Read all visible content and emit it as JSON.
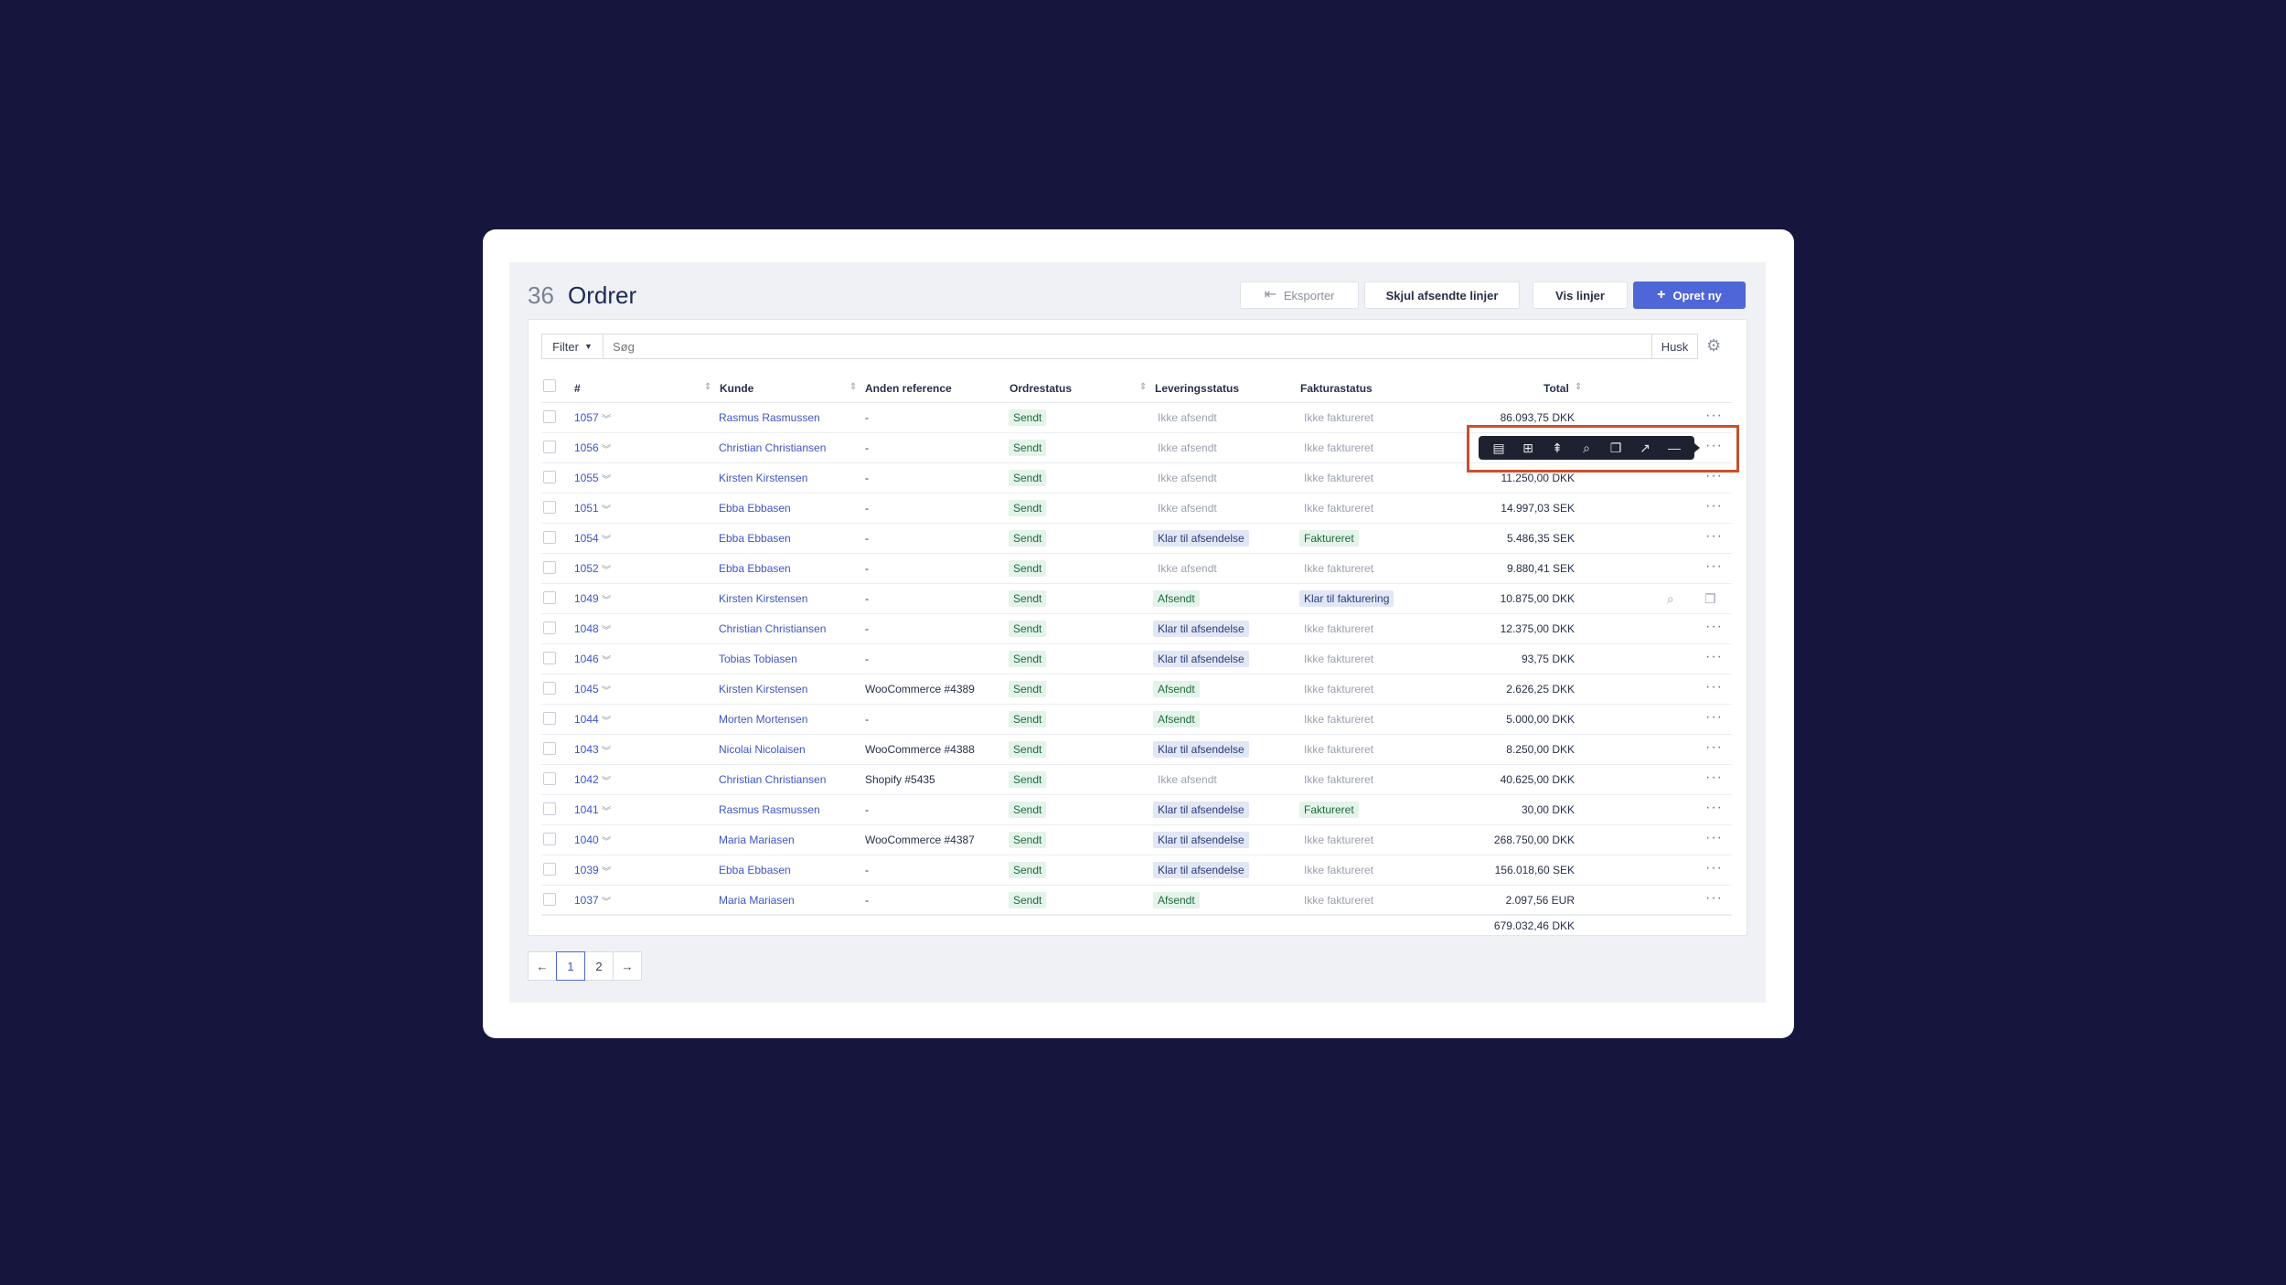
{
  "header": {
    "count": "36",
    "title": "Ordrer",
    "export_label": "Eksporter",
    "hide_sent_label": "Skjul afsendte linjer",
    "show_lines_label": "Vis linjer",
    "create_label": "Opret ny"
  },
  "filterbar": {
    "filter_label": "Filter",
    "search_placeholder": "Søg",
    "remember_label": "Husk"
  },
  "columns": {
    "number": "#",
    "customer": "Kunde",
    "reference": "Anden reference",
    "order_status": "Ordrestatus",
    "delivery_status": "Leveringsstatus",
    "invoice_status": "Fakturastatus",
    "total": "Total"
  },
  "rows": [
    {
      "id": "1057",
      "customer": "Rasmus Rasmussen",
      "ref": "-",
      "ostat": "Sendt",
      "lev": "Ikke afsendt",
      "lev_kind": "plain",
      "fakt": "Ikke faktureret",
      "fakt_kind": "plain",
      "total": "86.093,75 DKK"
    },
    {
      "id": "1056",
      "customer": "Christian Christiansen",
      "ref": "-",
      "ostat": "Sendt",
      "lev": "Ikke afsendt",
      "lev_kind": "plain",
      "fakt": "Ikke faktureret",
      "fakt_kind": "plain",
      "total": ""
    },
    {
      "id": "1055",
      "customer": "Kirsten Kirstensen",
      "ref": "-",
      "ostat": "Sendt",
      "lev": "Ikke afsendt",
      "lev_kind": "plain",
      "fakt": "Ikke faktureret",
      "fakt_kind": "plain",
      "total": "11.250,00 DKK"
    },
    {
      "id": "1051",
      "customer": "Ebba Ebbasen",
      "ref": "-",
      "ostat": "Sendt",
      "lev": "Ikke afsendt",
      "lev_kind": "plain",
      "fakt": "Ikke faktureret",
      "fakt_kind": "plain",
      "total": "14.997,03 SEK"
    },
    {
      "id": "1054",
      "customer": "Ebba Ebbasen",
      "ref": "-",
      "ostat": "Sendt",
      "lev": "Klar til afsendelse",
      "lev_kind": "blue",
      "fakt": "Faktureret",
      "fakt_kind": "green",
      "total": "5.486,35 SEK"
    },
    {
      "id": "1052",
      "customer": "Ebba Ebbasen",
      "ref": "-",
      "ostat": "Sendt",
      "lev": "Ikke afsendt",
      "lev_kind": "plain",
      "fakt": "Ikke faktureret",
      "fakt_kind": "plain",
      "total": "9.880,41 SEK"
    },
    {
      "id": "1049",
      "customer": "Kirsten Kirstensen",
      "ref": "-",
      "ostat": "Sendt",
      "lev": "Afsendt",
      "lev_kind": "green",
      "fakt": "Klar til fakturering",
      "fakt_kind": "blue",
      "total": "10.875,00 DKK"
    },
    {
      "id": "1048",
      "customer": "Christian Christiansen",
      "ref": "-",
      "ostat": "Sendt",
      "lev": "Klar til afsendelse",
      "lev_kind": "blue",
      "fakt": "Ikke faktureret",
      "fakt_kind": "plain",
      "total": "12.375,00 DKK"
    },
    {
      "id": "1046",
      "customer": "Tobias Tobiasen",
      "ref": "-",
      "ostat": "Sendt",
      "lev": "Klar til afsendelse",
      "lev_kind": "blue",
      "fakt": "Ikke faktureret",
      "fakt_kind": "plain",
      "total": "93,75 DKK"
    },
    {
      "id": "1045",
      "customer": "Kirsten Kirstensen",
      "ref": "WooCommerce #4389",
      "ostat": "Sendt",
      "lev": "Afsendt",
      "lev_kind": "green",
      "fakt": "Ikke faktureret",
      "fakt_kind": "plain",
      "total": "2.626,25 DKK"
    },
    {
      "id": "1044",
      "customer": "Morten Mortensen",
      "ref": "-",
      "ostat": "Sendt",
      "lev": "Afsendt",
      "lev_kind": "green",
      "fakt": "Ikke faktureret",
      "fakt_kind": "plain",
      "total": "5.000,00 DKK"
    },
    {
      "id": "1043",
      "customer": "Nicolai Nicolaisen",
      "ref": "WooCommerce #4388",
      "ostat": "Sendt",
      "lev": "Klar til afsendelse",
      "lev_kind": "blue",
      "fakt": "Ikke faktureret",
      "fakt_kind": "plain",
      "total": "8.250,00 DKK"
    },
    {
      "id": "1042",
      "customer": "Christian Christiansen",
      "ref": "Shopify #5435",
      "ostat": "Sendt",
      "lev": "Ikke afsendt",
      "lev_kind": "plain",
      "fakt": "Ikke faktureret",
      "fakt_kind": "plain",
      "total": "40.625,00 DKK"
    },
    {
      "id": "1041",
      "customer": "Rasmus Rasmussen",
      "ref": "-",
      "ostat": "Sendt",
      "lev": "Klar til afsendelse",
      "lev_kind": "blue",
      "fakt": "Faktureret",
      "fakt_kind": "green",
      "total": "30,00 DKK"
    },
    {
      "id": "1040",
      "customer": "Maria Mariasen",
      "ref": "WooCommerce #4387",
      "ostat": "Sendt",
      "lev": "Klar til afsendelse",
      "lev_kind": "blue",
      "fakt": "Ikke faktureret",
      "fakt_kind": "plain",
      "total": "268.750,00 DKK"
    },
    {
      "id": "1039",
      "customer": "Ebba Ebbasen",
      "ref": "-",
      "ostat": "Sendt",
      "lev": "Klar til afsendelse",
      "lev_kind": "blue",
      "fakt": "Ikke faktureret",
      "fakt_kind": "plain",
      "total": "156.018,60 SEK"
    },
    {
      "id": "1037",
      "customer": "Maria Mariasen",
      "ref": "-",
      "ostat": "Sendt",
      "lev": "Afsendt",
      "lev_kind": "green",
      "fakt": "Ikke faktureret",
      "fakt_kind": "plain",
      "total": "2.097,56 EUR"
    }
  ],
  "sum_total": "679.032,46 DKK",
  "pagination": {
    "prev_icon": "arrow-left-icon",
    "pages": [
      "1",
      "2"
    ],
    "current": "1",
    "next_icon": "arrow-right-icon"
  },
  "toolbar_icons": [
    "collapse-icon",
    "add-line-icon",
    "insert-line-icon",
    "search-doc-icon",
    "copy-icon",
    "open-external-icon",
    "minus-icon"
  ],
  "colors": {
    "background": "#15153d",
    "accent": "#4f66d8",
    "link": "#3d55c6",
    "highlight": "#c8502a",
    "tag_green": "#e4f4ea",
    "tag_blue": "#e2e7f6"
  }
}
